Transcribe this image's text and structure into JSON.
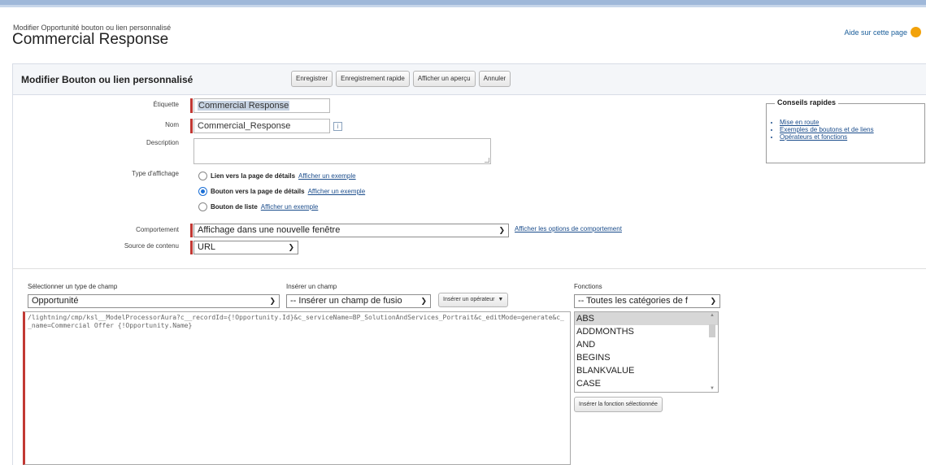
{
  "breadcrumb": "Modifier Opportunité bouton ou lien personnalisé",
  "page_title": "Commercial Response",
  "help_link": "Aide sur cette page",
  "panel": {
    "title": "Modifier Bouton ou lien personnalisé",
    "buttons": {
      "save": "Enregistrer",
      "quick_save": "Enregistrement rapide",
      "preview": "Afficher un aperçu",
      "cancel": "Annuler"
    }
  },
  "form": {
    "label_label": "Étiquette",
    "label_value": "Commercial Response",
    "name_label": "Nom",
    "name_value": "Commercial_Response",
    "info_icon": "i",
    "description_label": "Description",
    "description_value": "",
    "display_type_label": "Type d'affichage",
    "display_types": [
      {
        "label": "Lien vers la page de détails",
        "example": "Afficher un exemple",
        "selected": false
      },
      {
        "label": "Bouton vers la page de détails",
        "example": "Afficher un exemple",
        "selected": true
      },
      {
        "label": "Bouton de liste",
        "example": "Afficher un exemple",
        "selected": false
      }
    ],
    "behavior_label": "Comportement",
    "behavior_value": "Affichage dans une nouvelle fenêtre",
    "behavior_options_link": "Afficher les options de comportement",
    "content_source_label": "Source de contenu",
    "content_source_value": "URL"
  },
  "tips": {
    "title": "Conseils rapides",
    "links": [
      "Mise en route",
      "Exemples de boutons et de liens",
      "Opérateurs et fonctions"
    ]
  },
  "editor_section": {
    "field_type_label": "Sélectionner un type de champ",
    "field_type_value": "Opportunité",
    "insert_field_label": "Insérer un champ",
    "insert_field_value": "-- Insérer un champ de fusio",
    "insert_operator_button": "Insérer un opérateur",
    "functions_label": "Fonctions",
    "functions_category_value": "-- Toutes les catégories de f",
    "formula": "/lightning/cmp/ksl__ModelProcessorAura?c__recordId={!Opportunity.Id}&c_serviceName=BP_SolutionAndServices_Portrait&c_editMode=generate&c__name=Commercial Offer {!Opportunity.Name}",
    "functions": [
      "ABS",
      "ADDMONTHS",
      "AND",
      "BEGINS",
      "BLANKVALUE",
      "CASE"
    ],
    "insert_function_button": "Insérer la fonction sélectionnée"
  },
  "colors": {
    "required_bar": "#c23934",
    "link": "#1a4c8b",
    "header_bg": "#f4f6f9"
  }
}
